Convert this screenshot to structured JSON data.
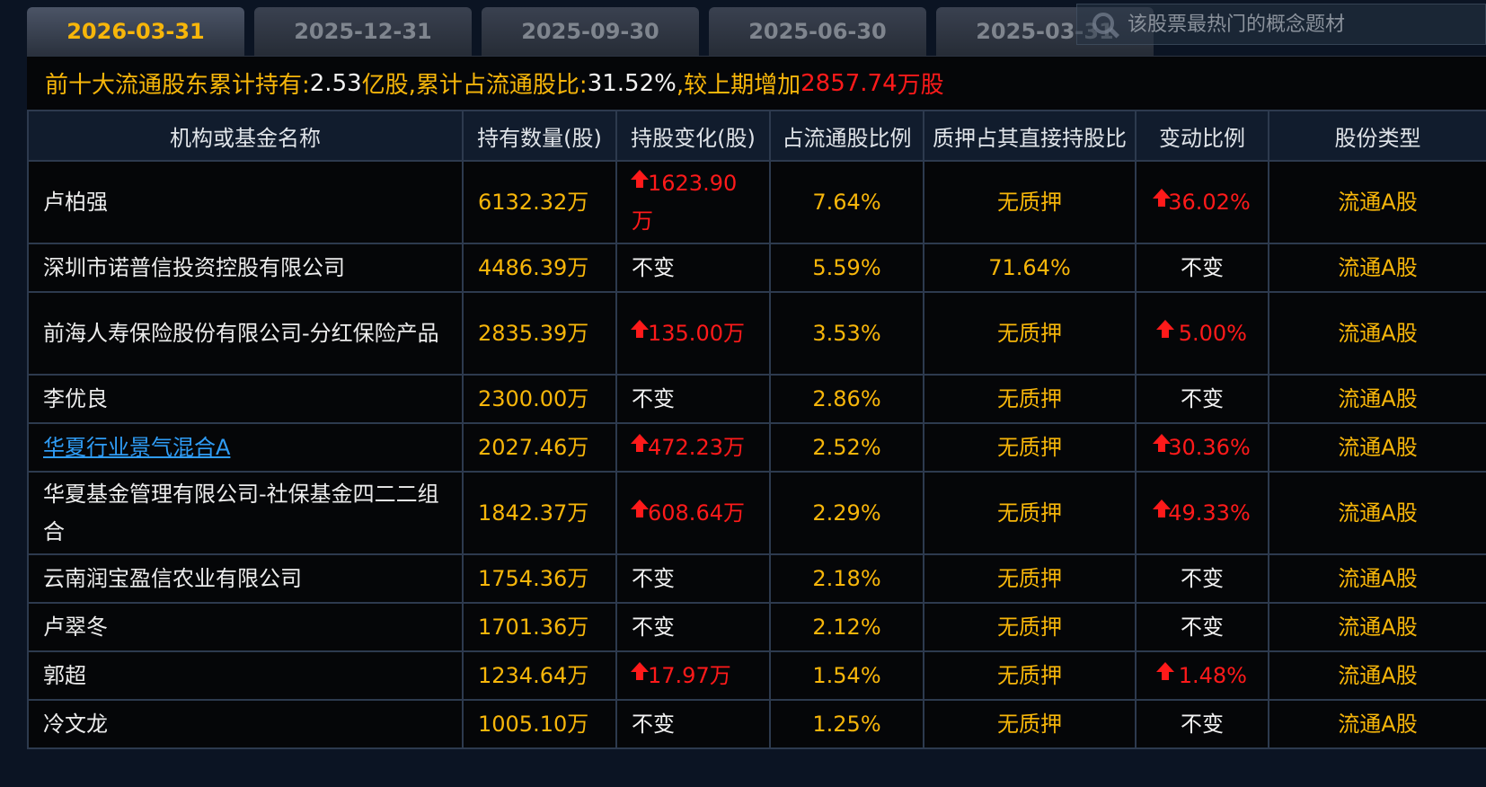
{
  "tabs": [
    {
      "label": "2026-03-31",
      "active": true
    },
    {
      "label": "2025-12-31",
      "active": false
    },
    {
      "label": "2025-09-30",
      "active": false
    },
    {
      "label": "2025-06-30",
      "active": false
    },
    {
      "label": "2025-03-31",
      "active": false
    }
  ],
  "search": {
    "placeholder": "该股票最热门的概念题材"
  },
  "summary": {
    "label_total": "前十大流通股东累计持有:",
    "total_value": "2.53",
    "total_unit": "亿股",
    "label_ratio": ",累计占流通股比:",
    "ratio_value": "31.52%",
    "label_change": " ,较上期增加",
    "change_value": "2857.74",
    "change_unit": "万股"
  },
  "table": {
    "headers": [
      "机构或基金名称",
      "持有数量(股)",
      "持股变化(股)",
      "占流通股比例",
      "质押占其直接持股比",
      "变动比例",
      "股份类型"
    ],
    "rows": [
      {
        "name": "卢柏强",
        "link": false,
        "qty": "6132.32万",
        "change": "1623.90万",
        "change_up": true,
        "ratio": "7.64%",
        "pledge": "无质押",
        "change_ratio": "36.02%",
        "ratio_up": true,
        "type": "流通A股"
      },
      {
        "name": "深圳市诺普信投资控股有限公司",
        "link": false,
        "qty": "4486.39万",
        "change": "不变",
        "change_up": false,
        "ratio": "5.59%",
        "pledge": "71.64%",
        "change_ratio": "不变",
        "ratio_up": false,
        "type": "流通A股"
      },
      {
        "name": "前海人寿保险股份有限公司-分红保险产品",
        "link": false,
        "qty": "2835.39万",
        "change": "135.00万",
        "change_up": true,
        "ratio": "3.53%",
        "pledge": "无质押",
        "change_ratio": " 5.00%",
        "ratio_up": true,
        "type": "流通A股"
      },
      {
        "name": "李优良",
        "link": false,
        "qty": "2300.00万",
        "change": "不变",
        "change_up": false,
        "ratio": "2.86%",
        "pledge": "无质押",
        "change_ratio": "不变",
        "ratio_up": false,
        "type": "流通A股"
      },
      {
        "name": "华夏行业景气混合A",
        "link": true,
        "qty": "2027.46万",
        "change": "472.23万",
        "change_up": true,
        "ratio": "2.52%",
        "pledge": "无质押",
        "change_ratio": "30.36%",
        "ratio_up": true,
        "type": "流通A股"
      },
      {
        "name": "华夏基金管理有限公司-社保基金四二二组合",
        "link": false,
        "qty": "1842.37万",
        "change": "608.64万",
        "change_up": true,
        "ratio": "2.29%",
        "pledge": "无质押",
        "change_ratio": "49.33%",
        "ratio_up": true,
        "type": "流通A股"
      },
      {
        "name": "云南润宝盈信农业有限公司",
        "link": false,
        "qty": "1754.36万",
        "change": "不变",
        "change_up": false,
        "ratio": "2.18%",
        "pledge": "无质押",
        "change_ratio": "不变",
        "ratio_up": false,
        "type": "流通A股"
      },
      {
        "name": "卢翠冬",
        "link": false,
        "qty": "1701.36万",
        "change": "不变",
        "change_up": false,
        "ratio": "2.12%",
        "pledge": "无质押",
        "change_ratio": "不变",
        "ratio_up": false,
        "type": "流通A股"
      },
      {
        "name": "郭超",
        "link": false,
        "qty": "1234.64万",
        "change": "17.97万",
        "change_up": true,
        "ratio": "1.54%",
        "pledge": "无质押",
        "change_ratio": " 1.48%",
        "ratio_up": true,
        "type": "流通A股"
      },
      {
        "name": "冷文龙",
        "link": false,
        "qty": "1005.10万",
        "change": "不变",
        "change_up": false,
        "ratio": "1.25%",
        "pledge": "无质押",
        "change_ratio": "不变",
        "ratio_up": false,
        "type": "流通A股"
      }
    ]
  },
  "colors": {
    "accent_yellow": "#f7b60a",
    "up_red": "#ff1a1a",
    "link_blue": "#2f9cf5",
    "background": "#0b1423"
  },
  "icons": {
    "search": "search-icon",
    "up": "up-arrow-icon"
  }
}
